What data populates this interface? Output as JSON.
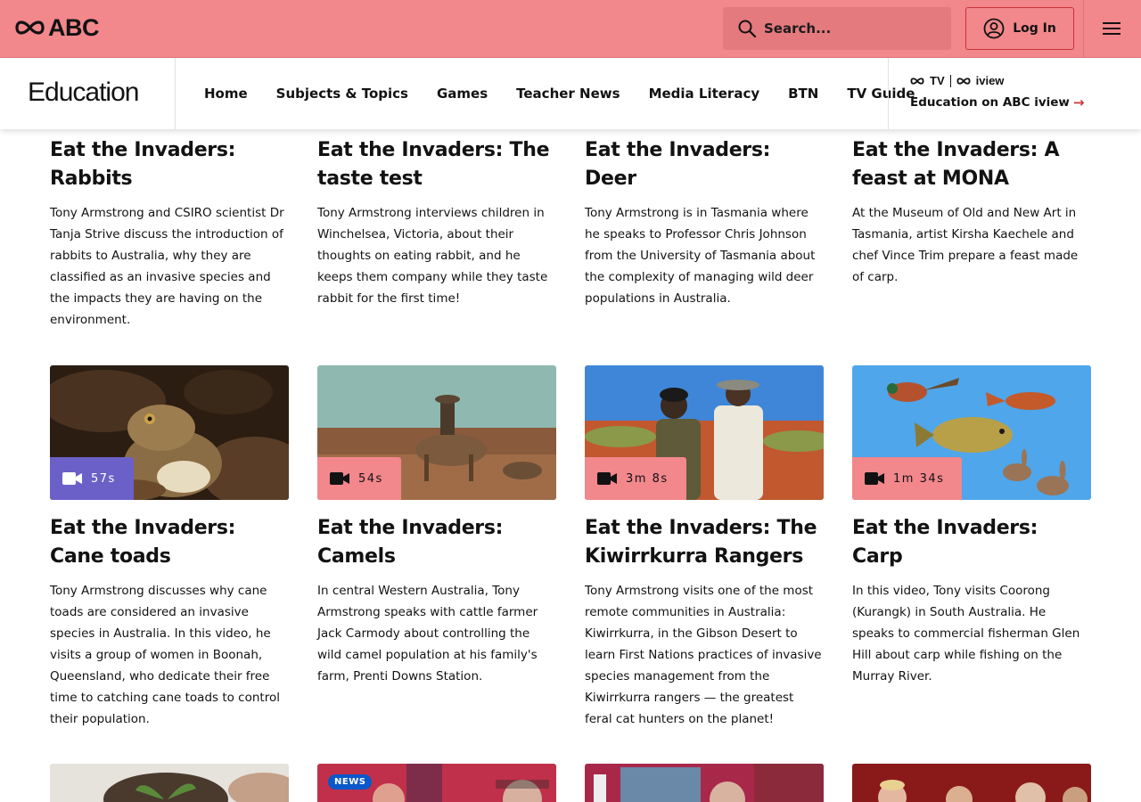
{
  "header": {
    "brand": "ABC",
    "search_placeholder": "Search...",
    "login_label": "Log In"
  },
  "subnav": {
    "section_title": "Education",
    "links": [
      "Home",
      "Subjects & Topics",
      "Games",
      "Teacher News",
      "Media Literacy",
      "BTN",
      "TV Guide"
    ],
    "iview_tv": "TV",
    "iview_brand": "iview",
    "iview_link": "Education on ABC iview"
  },
  "row1": [
    {
      "title": "Eat the Invaders: Rabbits",
      "desc": "Tony Armstrong and CSIRO scientist Dr Tanja Strive discuss the introduction of rabbits to Australia, why they are classified as an invasive species and the impacts they are having on the environment."
    },
    {
      "title": "Eat the Invaders: The taste test",
      "desc": "Tony Armstrong interviews children in Winchelsea, Victoria, about their thoughts on eating rabbit, and he keeps them company while they taste rabbit for the first time!"
    },
    {
      "title": "Eat the Invaders: Deer",
      "desc": "Tony Armstrong is in Tasmania where he speaks to Professor Chris Johnson from the University of Tasmania about the complexity of managing wild deer populations in Australia."
    },
    {
      "title": "Eat the Invaders: A feast at MONA",
      "desc": "At the Museum of Old and New Art in Tasmania, artist Kirsha Kaechele and chef Vince Trim prepare a feast made of carp."
    }
  ],
  "row2": [
    {
      "title": "Eat the Invaders: Cane toads",
      "duration": "57s",
      "desc": "Tony Armstrong discusses why cane toads are considered an invasive species in Australia. In this video, he visits a group of women in Boonah, Queensland, who dedicate their free time to catching cane toads to control their population."
    },
    {
      "title": "Eat the Invaders: Camels",
      "duration": "54s",
      "desc": "In central Western Australia, Tony Armstrong speaks with cattle farmer Jack Carmody about controlling the wild camel population at his family's farm, Prenti Downs Station."
    },
    {
      "title": "Eat the Invaders: The Kiwirrkurra Rangers",
      "duration": "3m 8s",
      "desc": "Tony Armstrong visits one of the most remote communities in Australia: Kiwirrkurra, in the Gibson Desert to learn First Nations practices of invasive species management from the Kiwirrkurra rangers — the greatest feral cat hunters on the planet!"
    },
    {
      "title": "Eat the Invaders: Carp",
      "duration": "1m 34s",
      "desc": "In this video, Tony visits Coorong (Kurangk) in South Australia. He speaks to commercial fisherman Glen Hill about carp while fishing on the Murray River."
    }
  ],
  "row3": {
    "news_badge": "NEWS"
  },
  "colors": {
    "header_bg": "#f2878c",
    "accent": "#c8343b",
    "active_badge": "#6b60c8"
  }
}
